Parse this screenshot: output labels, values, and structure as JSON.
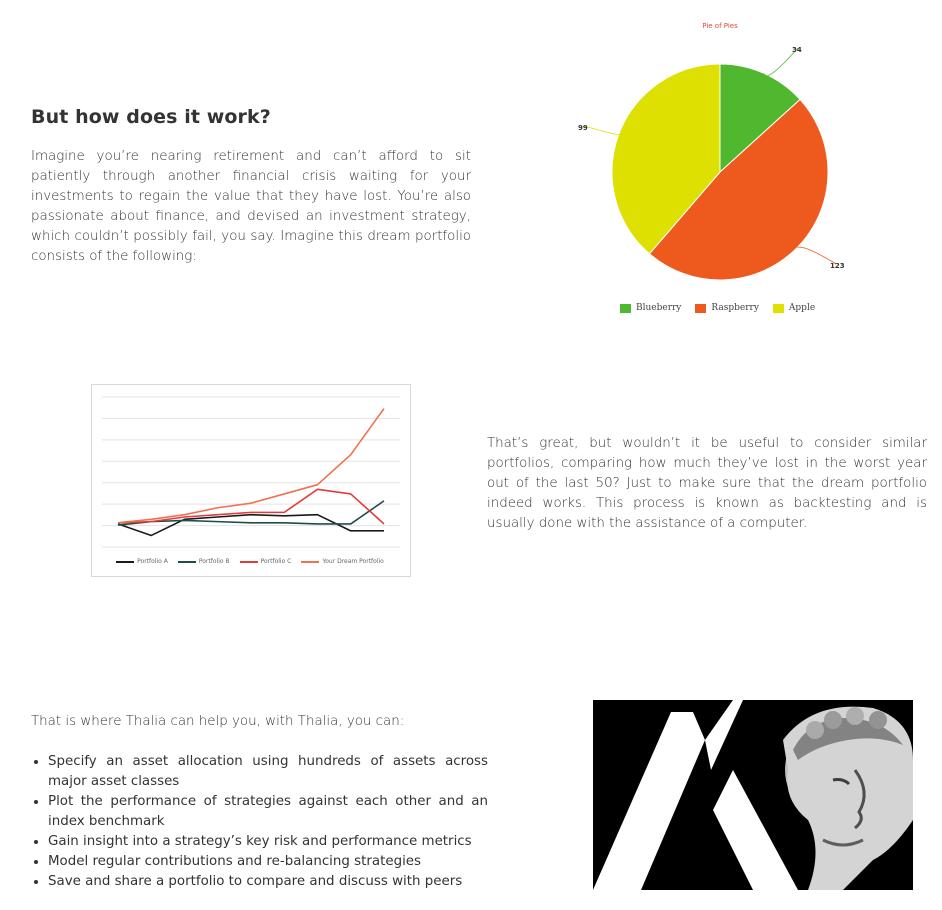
{
  "section1": {
    "heading": "But how does it work?",
    "paragraph": "Imagine you’re nearing retirement and can’t afford to sit patiently through another financial crisis waiting for your investments to regain the value that they have lost. You’re also passionate about finance, and devised an investment strategy, which couldn’t possibly fail, you say. Imagine this dream portfolio consists of the following:"
  },
  "section2": {
    "paragraph": "That’s great, but wouldn’t it be useful to consider similar portfolios, comparing how much they’ve lost in the worst year out of the last 50? Just to make sure that the dream portfolio indeed works. This process is known as backtesting and is usually done with the assistance of a computer."
  },
  "section3": {
    "intro": "That is where Thalia can help you, with Thalia, you can:",
    "features": [
      "Specify an asset allocation using hundreds of assets across major asset classes",
      "Plot the performance of strategies against each other and an index benchmark",
      "Gain insight into a strategy’s key risk and performance metrics",
      "Model regular contributions and re-balancing strategies",
      "Save and share a portfolio to compare and discuss with peers"
    ]
  },
  "chart_data": [
    {
      "type": "pie",
      "title": "Pie of Pies",
      "categories": [
        "Blueberry",
        "Raspberry",
        "Apple"
      ],
      "values": [
        34,
        123,
        99
      ],
      "colors": [
        "#4fb82e",
        "#ee5a1e",
        "#dde000"
      ],
      "data_labels": [
        "34",
        "123",
        "99"
      ],
      "legend": "bottom"
    },
    {
      "type": "line",
      "title": "",
      "x": [
        1,
        2,
        3,
        4,
        5,
        6,
        7,
        8,
        9
      ],
      "ylim": [
        -1,
        5.5
      ],
      "grid": true,
      "legend": "bottom",
      "series": [
        {
          "name": "Portfolio A",
          "color": "#1a1a1a",
          "values": [
            0,
            -0.5,
            0.2,
            0.3,
            0.4,
            0.35,
            0.4,
            -0.3,
            -0.3
          ]
        },
        {
          "name": "Portfolio B",
          "color": "#1f4e4a",
          "values": [
            -0.05,
            0.1,
            0.15,
            0.1,
            0.05,
            0.05,
            0.0,
            0.0,
            1.0
          ]
        },
        {
          "name": "Portfolio C",
          "color": "#e03c3c",
          "values": [
            0.05,
            0.1,
            0.3,
            0.4,
            0.5,
            0.5,
            1.5,
            1.3,
            0.0
          ]
        },
        {
          "name": "Your Dream Portfolio",
          "color": "#f07050",
          "values": [
            0.05,
            0.2,
            0.4,
            0.7,
            0.9,
            1.3,
            1.7,
            3.0,
            5.0
          ]
        }
      ]
    }
  ],
  "logo": {
    "name": "thalia-logo",
    "colors": {
      "background": "#000000",
      "mark": "#ffffff"
    }
  }
}
